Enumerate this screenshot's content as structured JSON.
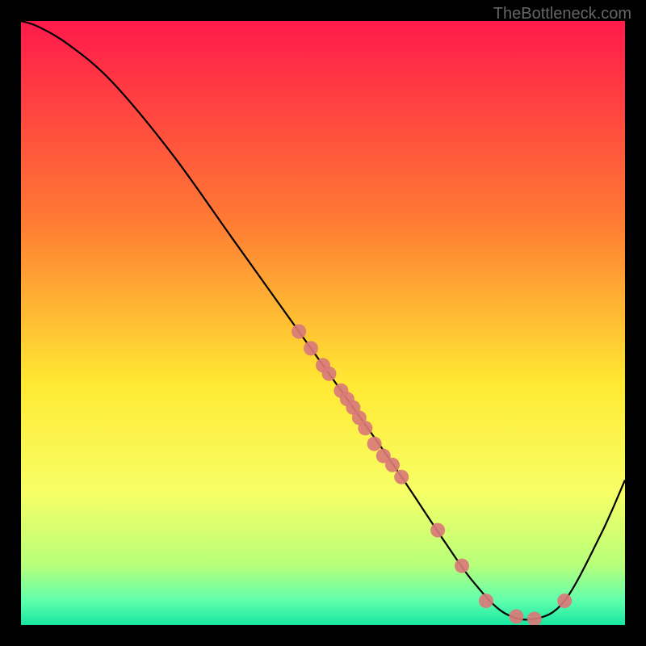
{
  "attribution": "TheBottleneck.com",
  "chart_data": {
    "type": "line",
    "title": "",
    "xlabel": "",
    "ylabel": "",
    "xlim": [
      0,
      100
    ],
    "ylim": [
      0,
      100
    ],
    "background_gradient": {
      "stops": [
        {
          "offset": 0.0,
          "color": "#ff1a4b"
        },
        {
          "offset": 0.33,
          "color": "#ff7a33"
        },
        {
          "offset": 0.6,
          "color": "#ffe933"
        },
        {
          "offset": 0.78,
          "color": "#f7ff66"
        },
        {
          "offset": 0.9,
          "color": "#b8ff7a"
        },
        {
          "offset": 0.96,
          "color": "#5fffad"
        },
        {
          "offset": 1.0,
          "color": "#17e6a0"
        }
      ]
    },
    "series": [
      {
        "name": "curve",
        "color": "#000000",
        "type": "line",
        "x": [
          0,
          3,
          8,
          15,
          25,
          35,
          45,
          55,
          62,
          70,
          75,
          80,
          85,
          90,
          96,
          100
        ],
        "y": [
          100,
          99,
          96,
          90,
          78,
          64,
          50,
          36,
          26,
          14,
          7,
          2,
          1,
          4,
          15,
          24
        ]
      },
      {
        "name": "markers-on-curve",
        "color": "#d97a78",
        "type": "scatter",
        "x": [
          46,
          48,
          50,
          51,
          53,
          54,
          55,
          56,
          57,
          58.5,
          60,
          61.5,
          63,
          69,
          73,
          77,
          82,
          85,
          90
        ],
        "y": [
          48.6,
          45.8,
          43.0,
          41.6,
          38.8,
          37.4,
          36.0,
          34.3,
          32.6,
          30.0,
          28.0,
          26.5,
          24.5,
          15.7,
          9.8,
          4.0,
          1.4,
          1.0,
          4.0
        ]
      }
    ]
  }
}
